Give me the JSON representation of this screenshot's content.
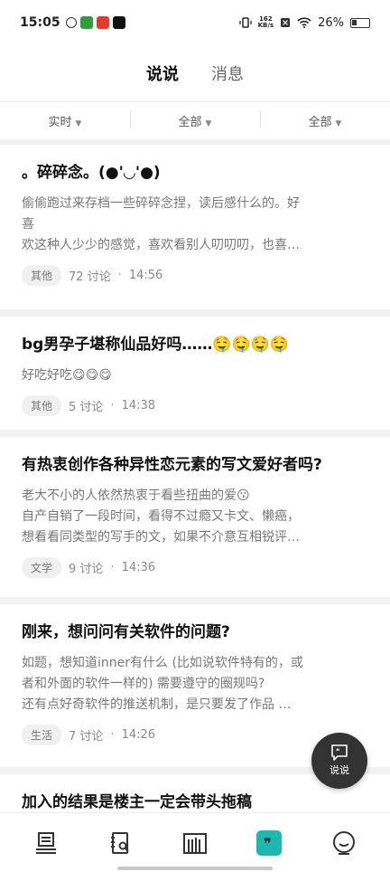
{
  "status_bar": {
    "time": "15:05",
    "net_speed_value": "162",
    "net_speed_unit": "KB/s",
    "battery": "26%"
  },
  "tabs": [
    {
      "label": "说说",
      "active": true
    },
    {
      "label": "消息",
      "active": false
    }
  ],
  "filters": [
    {
      "label": "实时"
    },
    {
      "label": "全部"
    },
    {
      "label": "全部"
    }
  ],
  "posts": [
    {
      "title": "。碎碎念。(●'◡'●)",
      "body": [
        "偷偷跑过来存档一些碎碎念捏，读后感什么的。好",
        "喜",
        "欢这种人少少的感觉，喜欢看别人叨叨叨，也喜…"
      ],
      "tag": "其他",
      "discussions": "72 讨论",
      "time": "14:56"
    },
    {
      "title": "bg男孕子堪称仙品好吗……🤤🤤🤤🤤",
      "body": [
        "好吃好吃😋😋😋"
      ],
      "tag": "其他",
      "discussions": "5 讨论",
      "time": "14:38"
    },
    {
      "title": "有热衷创作各种异性恋元素的写文爱好者吗?",
      "body": [
        "老大不小的人依然热衷于看些扭曲的爱😗",
        "自产自销了一段时间，看得不过瘾又卡文、懒癌，",
        "想看看同类型的写手的文，如果不介意互相锐评…"
      ],
      "tag": "文学",
      "discussions": "9 讨论",
      "time": "14:36"
    },
    {
      "title": "刚来，想问问有关软件的问题?",
      "body": [
        "如题，想知道inner有什么 (比如说软件特有的，或",
        "者和外面的软件一样的) 需要遵守的圈规吗?",
        "还有点好奇软件的推送机制，是只要发了作品 …"
      ],
      "tag": "生活",
      "discussions": "7 讨论",
      "time": "14:26"
    },
    {
      "title": "加入的结果是楼主一定会带头拖稿",
      "body": [],
      "tag": "",
      "discussions": "",
      "time": ""
    }
  ],
  "fab": {
    "label": "说说"
  },
  "bottom_nav": [
    {
      "icon": "stack-icon",
      "active": false
    },
    {
      "icon": "notebook-search-icon",
      "active": false
    },
    {
      "icon": "library-icon",
      "active": false
    },
    {
      "icon": "quote-icon",
      "active": true
    },
    {
      "icon": "smile-face-icon",
      "active": false
    }
  ],
  "colors": {
    "accent": "#22c6c1",
    "fab": "#333333"
  }
}
